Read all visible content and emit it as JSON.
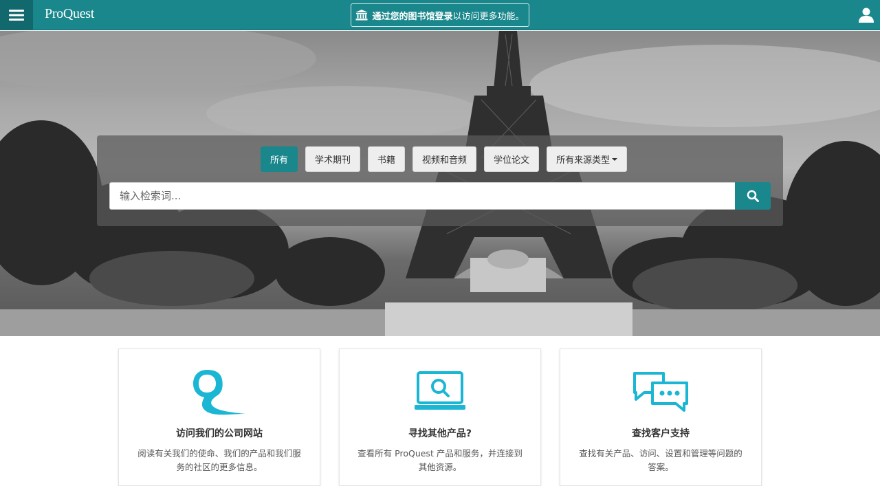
{
  "header": {
    "logo": "ProQuest",
    "login_bold": "通过您的图书馆登录",
    "login_rest": "以访问更多功能。"
  },
  "search": {
    "tabs": [
      {
        "label": "所有",
        "active": true
      },
      {
        "label": "学术期刊",
        "active": false
      },
      {
        "label": "书籍",
        "active": false
      },
      {
        "label": "视频和音频",
        "active": false
      },
      {
        "label": "学位论文",
        "active": false
      },
      {
        "label": "所有来源类型",
        "active": false
      }
    ],
    "placeholder": "输入检索词..."
  },
  "cards": [
    {
      "title": "访问我们的公司网站",
      "desc": "阅读有关我们的使命、我们的产品和我们服务的社区的更多信息。",
      "icon": "proquest-q-icon"
    },
    {
      "title": "寻找其他产品?",
      "desc": "查看所有 ProQuest 产品和服务，并连接到其他资源。",
      "icon": "laptop-search-icon"
    },
    {
      "title": "查找客户支持",
      "desc": "查找有关产品、访问、设置和管理等问题的答案。",
      "icon": "chat-bubbles-icon"
    }
  ],
  "colors": {
    "brand": "#1a878c",
    "accent_icon": "#1ab6d4"
  }
}
